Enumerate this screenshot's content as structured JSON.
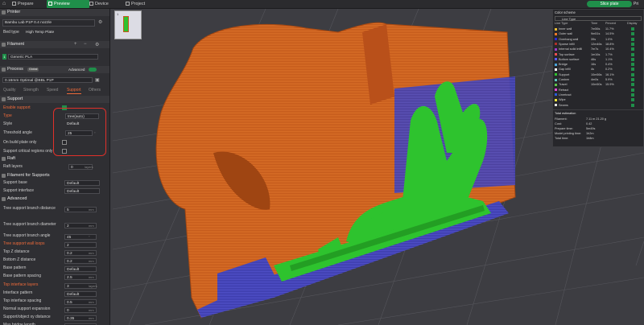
{
  "tabs": [
    {
      "label": "Prepare",
      "active": false
    },
    {
      "label": "Preview",
      "active": true
    },
    {
      "label": "Device",
      "active": false
    },
    {
      "label": "Project",
      "active": false
    }
  ],
  "slice_button": "Slice plate",
  "print_button": "Pri",
  "printer": {
    "section_title": "Printer",
    "name": "Bambu Lab P1P 0.4 nozzle",
    "bed_type_label": "Bed type",
    "bed_type_value": "High Temp Plate"
  },
  "filament": {
    "section_title": "Filament",
    "slot_number": "1",
    "name": "Generic PLA"
  },
  "process": {
    "section_title": "Process",
    "global_badge": "Global",
    "advanced_label": "Advanced",
    "profile": "0.16mm Optimal @BBL P1P",
    "subtabs": [
      "Quality",
      "Strength",
      "Speed",
      "Support",
      "Others"
    ],
    "active_subtab": "Support"
  },
  "support": {
    "section_title": "Support",
    "enable_label": "Enable support",
    "type_label": "Type",
    "type_value": "tree(auto)",
    "style_label": "Style",
    "style_value": "Default",
    "threshold_label": "Threshold angle",
    "threshold_value": "25",
    "threshold_unit": "°",
    "build_plate_only_label": "On build plate only",
    "critical_label": "Support critical regions only"
  },
  "raft": {
    "section_title": "Raft",
    "layers_label": "Raft layers",
    "layers_value": "0",
    "layers_unit": "layers"
  },
  "filament_for_supports": {
    "section_title": "Filament for Supports",
    "base_label": "Support base",
    "base_value": "Default",
    "interface_label": "Support interface",
    "interface_value": "Default"
  },
  "advanced": {
    "section_title": "Advanced",
    "rows": [
      {
        "label": "Tree support branch distance",
        "value": "5",
        "unit": "mm",
        "orange": false
      },
      {
        "label": "Tree support branch diameter",
        "value": "2",
        "unit": "mm",
        "orange": false
      },
      {
        "label": "Tree support branch angle",
        "value": "45",
        "unit": "°",
        "orange": false
      },
      {
        "label": "Tree support wall loops",
        "value": "2",
        "unit": "",
        "orange": true
      },
      {
        "label": "Top Z distance",
        "value": "0.2",
        "unit": "mm",
        "orange": false
      },
      {
        "label": "Bottom Z distance",
        "value": "0.2",
        "unit": "mm",
        "orange": false
      },
      {
        "label": "Base pattern",
        "value": "Default",
        "unit": "",
        "orange": false
      },
      {
        "label": "Base pattern spacing",
        "value": "2.5",
        "unit": "mm",
        "orange": false
      },
      {
        "label": "Top interface layers",
        "value": "3",
        "unit": "layers",
        "orange": true
      },
      {
        "label": "Interface pattern",
        "value": "Default",
        "unit": "",
        "orange": false
      },
      {
        "label": "Top interface spacing",
        "value": "0.5",
        "unit": "mm",
        "orange": false
      },
      {
        "label": "Normal support expansion",
        "value": "0",
        "unit": "mm",
        "orange": false
      },
      {
        "label": "Support/object xy distance",
        "value": "0.35",
        "unit": "mm",
        "orange": false
      },
      {
        "label": "Max bridge length",
        "value": "10",
        "unit": "mm",
        "orange": false
      }
    ]
  },
  "legend": {
    "color_scheme_label": "Color scheme",
    "scheme_value": "Line Type",
    "columns": [
      "Line Type",
      "Time",
      "Percent",
      "Display"
    ],
    "rows": [
      {
        "name": "Inner wall",
        "time": "7m56s",
        "percent": "11.7%",
        "color": "#e8be34"
      },
      {
        "name": "Outer wall",
        "time": "9m51s",
        "percent": "14.5%",
        "color": "#ef7a28"
      },
      {
        "name": "Overhang wall",
        "time": "39s",
        "percent": "1.0%",
        "color": "#2b2bd6"
      },
      {
        "name": "Sparse infill",
        "time": "12m46s",
        "percent": "18.8%",
        "color": "#b03029"
      },
      {
        "name": "Internal solid infill",
        "time": "7m7s",
        "percent": "10.4%",
        "color": "#9a3ccc"
      },
      {
        "name": "Top surface",
        "time": "1m16s",
        "percent": "1.7%",
        "color": "#f24f50"
      },
      {
        "name": "Bottom surface",
        "time": "46s",
        "percent": "1.1%",
        "color": "#5a5aff"
      },
      {
        "name": "Bridge",
        "time": "16s",
        "percent": "0.4%",
        "color": "#4aa3d9"
      },
      {
        "name": "Gap infill",
        "time": "4s",
        "percent": "0.2%",
        "color": "#ffffff"
      },
      {
        "name": "Support",
        "time": "10m56s",
        "percent": "16.1%",
        "color": "#2ec32e"
      },
      {
        "name": "Custom",
        "time": "4m0s",
        "percent": "5.9%",
        "color": "#5ec5bf"
      },
      {
        "name": "Travel",
        "time": "10m50s",
        "percent": "15.9%",
        "color": "#5ec44a"
      },
      {
        "name": "Retract",
        "time": "",
        "percent": "",
        "color": "#e04ad6"
      },
      {
        "name": "Unretract",
        "time": "",
        "percent": "",
        "color": "#2b5cd8"
      },
      {
        "name": "Wipe",
        "time": "",
        "percent": "",
        "color": "#f2e53a"
      },
      {
        "name": "Seams",
        "time": "",
        "percent": "",
        "color": "#e0e0e0"
      }
    ],
    "total_title": "Total estimation",
    "totals": [
      {
        "label": "Filament:",
        "value": "7.11 m    21.20 g"
      },
      {
        "label": "Cost:",
        "value": "0.42"
      },
      {
        "label": "Prepare time:",
        "value": "5m49s"
      },
      {
        "label": "Model printing time:",
        "value": "1h2m"
      },
      {
        "label": "Total time:",
        "value": "1h8m"
      }
    ]
  }
}
